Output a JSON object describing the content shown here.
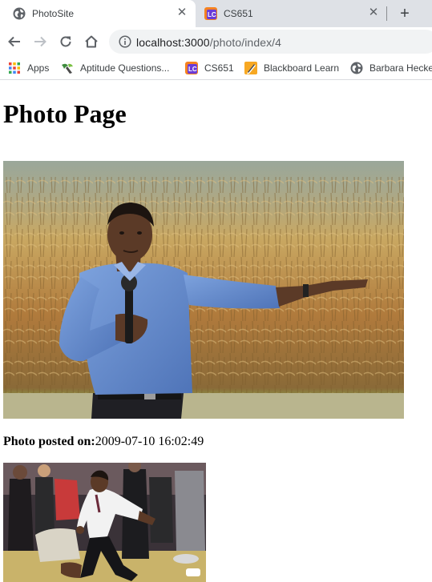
{
  "browser": {
    "tabs": [
      {
        "title": "PhotoSite",
        "active": true,
        "icon": "globe-icon"
      },
      {
        "title": "CS651",
        "active": false,
        "icon": "lc-icon"
      }
    ],
    "new_tab_label": "+",
    "close_glyph": "✕",
    "address": {
      "host": "localhost:3000",
      "path": "/photo/index/4"
    },
    "bookmarks": [
      {
        "label": "Apps",
        "icon": "apps-grid-icon"
      },
      {
        "label": "Aptitude Questions...",
        "icon": "aptitude-icon"
      },
      {
        "label": "CS651",
        "icon": "lc-icon"
      },
      {
        "label": "Blackboard Learn",
        "icon": "blackboard-icon"
      },
      {
        "label": "Barbara Hecker",
        "icon": "globe-icon"
      }
    ]
  },
  "page": {
    "heading": "Photo Page",
    "posted_label": "Photo posted on:",
    "posted_value": "2009-07-10 16:02:49"
  },
  "colors": {
    "tabstrip_bg": "#dee1e6",
    "omnibox_bg": "#f1f3f4",
    "lc_orange": "#f58220",
    "lc_purple": "#6a3bd8"
  }
}
